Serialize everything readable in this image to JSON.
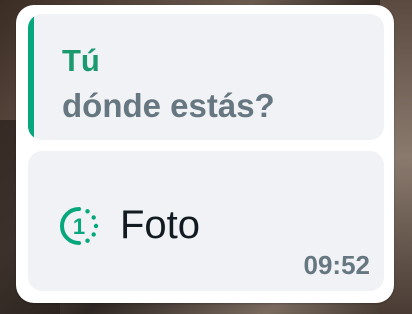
{
  "reply": {
    "author": "Tú",
    "text": "dónde estás?"
  },
  "message": {
    "media_label": "Foto",
    "view_once_count": "1",
    "timestamp": "09:52"
  },
  "colors": {
    "accent": "#06a77d",
    "author_text": "#1a9a6e",
    "muted_text": "#667781",
    "primary_text": "#111b21",
    "card_bg": "#f0f2f5"
  },
  "icons": {
    "view_once": "view-once-icon"
  }
}
